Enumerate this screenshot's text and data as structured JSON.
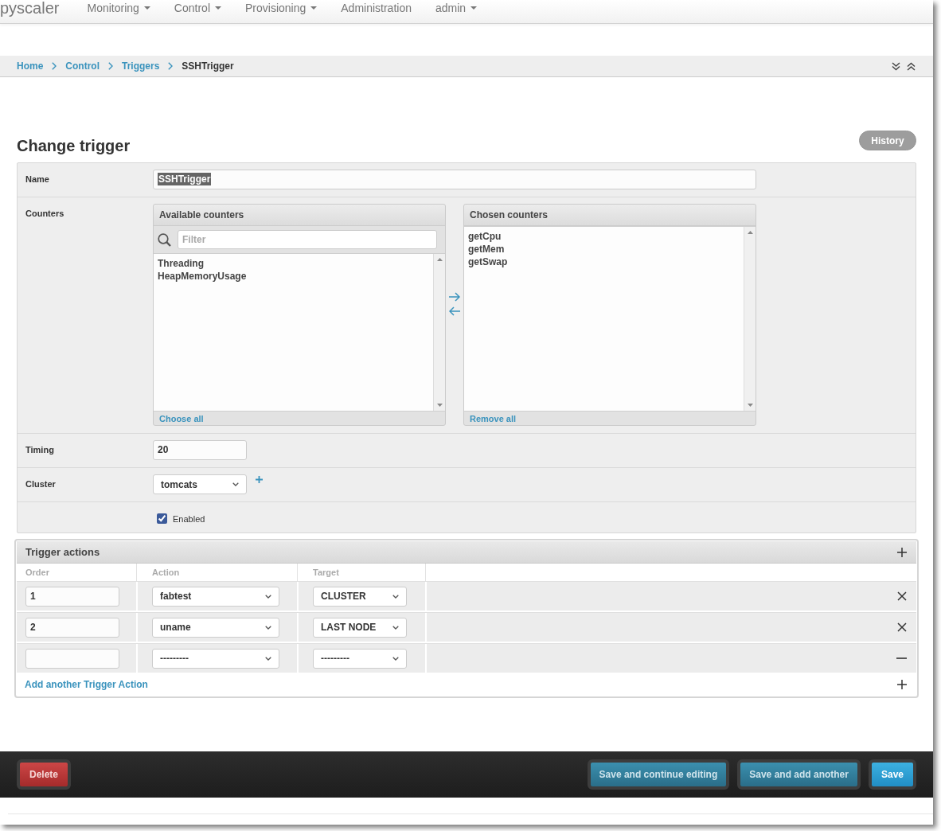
{
  "navbar": {
    "brand": "pyscaler",
    "menu": [
      {
        "label": "Monitoring",
        "dropdown": true
      },
      {
        "label": "Control",
        "dropdown": true
      },
      {
        "label": "Provisioning",
        "dropdown": true
      },
      {
        "label": "Administration",
        "dropdown": false
      },
      {
        "label": "admin",
        "dropdown": true
      }
    ]
  },
  "breadcrumbs": [
    {
      "label": "Home",
      "current": false
    },
    {
      "label": "Control",
      "current": false
    },
    {
      "label": "Triggers",
      "current": false
    },
    {
      "label": "SSHTrigger",
      "current": true
    }
  ],
  "page_title": "Change trigger",
  "history_button": {
    "label": "History"
  },
  "form": {
    "fields": [
      {
        "kind": "text",
        "label": "Name",
        "value": "SSHTrigger",
        "text_selected": true
      },
      {
        "kind": "selector",
        "label": "Counters",
        "available": {
          "title": "Available counters",
          "filter_placeholder": "Filter",
          "items": [
            "Threading",
            "HeapMemoryUsage"
          ],
          "footer_link": "Choose all"
        },
        "chosen": {
          "title": "Chosen counters",
          "items": [
            "getCpu",
            "getMem",
            "getSwap"
          ],
          "footer_link": "Remove all"
        }
      },
      {
        "kind": "number",
        "label": "Timing",
        "value": "20"
      },
      {
        "kind": "select",
        "label": "Cluster",
        "value": "tomcats",
        "add_button": true
      },
      {
        "kind": "checkbox",
        "label": "Enabled",
        "checked": true
      }
    ]
  },
  "trigger_actions": {
    "title": "Trigger actions",
    "columns": [
      "Order",
      "Action",
      "Target"
    ],
    "rows": [
      {
        "kind": "existing",
        "order": "1",
        "action": "fabtest",
        "target": "CLUSTER"
      },
      {
        "kind": "existing",
        "order": "2",
        "action": "uname",
        "target": "LAST NODE"
      },
      {
        "kind": "extra",
        "action": "---------",
        "target": "---------"
      }
    ],
    "add_link": "Add another Trigger Action"
  },
  "action_bar": {
    "buttons": [
      {
        "kind": "danger",
        "label": "Delete"
      },
      {
        "kind": "secondary",
        "label": "Save and continue editing"
      },
      {
        "kind": "secondary",
        "label": "Save and add another"
      },
      {
        "kind": "primary",
        "label": "Save"
      }
    ]
  }
}
